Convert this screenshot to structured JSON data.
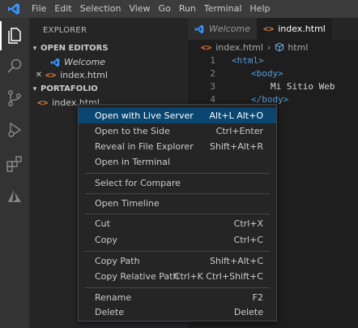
{
  "menubar": {
    "items": [
      "File",
      "Edit",
      "Selection",
      "View",
      "Go",
      "Run",
      "Terminal",
      "Help"
    ]
  },
  "activity_bar": {
    "icons": [
      "files-icon",
      "search-icon",
      "source-control-icon",
      "run-debug-icon",
      "extensions-icon",
      "azure-icon"
    ]
  },
  "sidebar": {
    "title": "EXPLORER",
    "open_editors": {
      "header": "OPEN EDITORS",
      "items": [
        {
          "label": "Welcome",
          "italic": true
        },
        {
          "label": "index.html",
          "close": "✕"
        }
      ]
    },
    "folder": {
      "header": "PORTAFOLIO",
      "items": [
        {
          "label": "index.html"
        }
      ]
    }
  },
  "editor": {
    "tabs": [
      {
        "label": "Welcome",
        "active": false
      },
      {
        "label": "index.html",
        "active": true
      }
    ],
    "breadcrumb": {
      "file": "index.html",
      "sep": "›",
      "symbol": "html"
    },
    "lines": [
      {
        "num": "1",
        "code": "<html>"
      },
      {
        "num": "2",
        "code": "<body>"
      },
      {
        "num": "3",
        "code": "Mi Sitio Web"
      },
      {
        "num": "4",
        "code": "</body>"
      }
    ]
  },
  "context_menu": {
    "items": [
      {
        "label": "Open with Live Server",
        "shortcut": "Alt+L Alt+O",
        "highlighted": true
      },
      {
        "label": "Open to the Side",
        "shortcut": "Ctrl+Enter"
      },
      {
        "label": "Reveal in File Explorer",
        "shortcut": "Shift+Alt+R"
      },
      {
        "label": "Open in Terminal",
        "shortcut": ""
      },
      {
        "label": "Select for Compare",
        "shortcut": ""
      },
      {
        "label": "Open Timeline",
        "shortcut": ""
      },
      {
        "label": "Cut",
        "shortcut": "Ctrl+X"
      },
      {
        "label": "Copy",
        "shortcut": "Ctrl+C"
      },
      {
        "label": "Copy Path",
        "shortcut": "Shift+Alt+C"
      },
      {
        "label": "Copy Relative Path",
        "shortcut": "Ctrl+K Ctrl+Shift+C"
      },
      {
        "label": "Rename",
        "shortcut": "F2"
      },
      {
        "label": "Delete",
        "shortcut": "Delete"
      }
    ]
  },
  "colors": {
    "accent": "#094771",
    "vscode_blue": "#3794ff",
    "html_icon": "#e37933",
    "tag": "#569cd6"
  }
}
